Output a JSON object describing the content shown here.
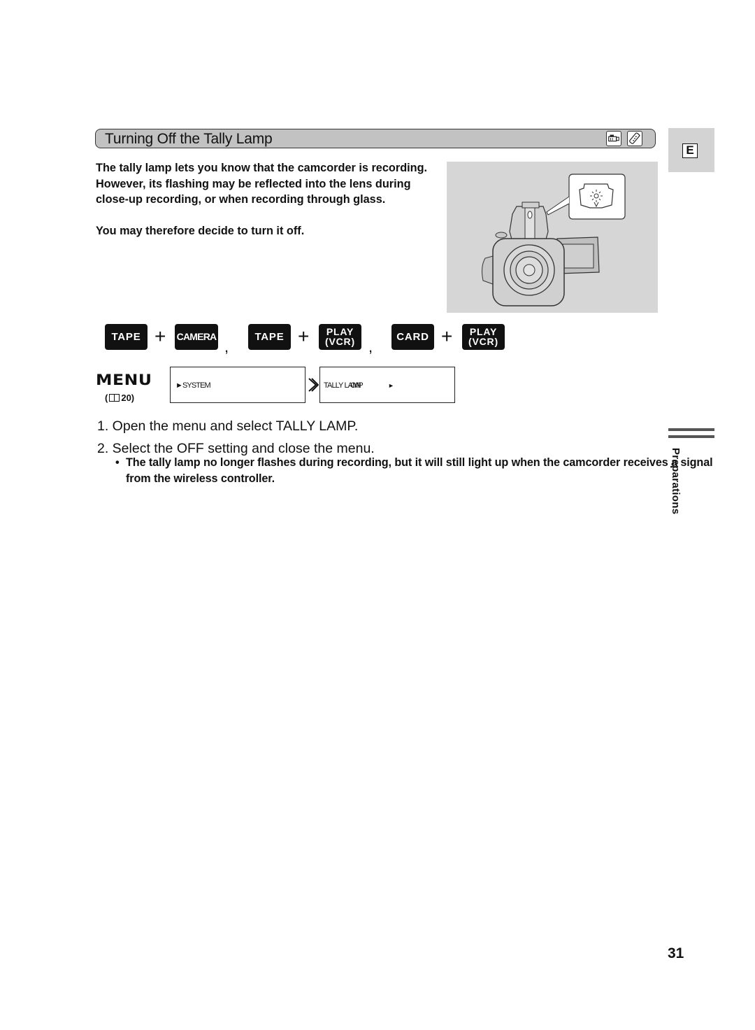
{
  "section": {
    "title": "Turning Off the Tally Lamp",
    "mode_icons": [
      "camcorder-icon",
      "wireless-controller-icon"
    ]
  },
  "language_tab": {
    "label": "E"
  },
  "intro": {
    "lines": [
      "The tally lamp lets you know that the camcorder is recording.",
      "However, its flashing may be reflected into the lens during",
      "close-up recording, or when recording through glass."
    ],
    "note": "You may therefore decide to turn it off."
  },
  "illustration": {
    "subject": "camcorder-front-with-tally-lamp-callout",
    "background": "#d6d6d6"
  },
  "modes": [
    {
      "dial": "TAPE",
      "mode_line1": "CAMERA",
      "mode_line2": ""
    },
    {
      "dial": "TAPE",
      "mode_line1": "PLAY",
      "mode_line2": "(VCR)"
    },
    {
      "dial": "CARD",
      "mode_line1": "PLAY",
      "mode_line2": "(VCR)"
    }
  ],
  "mode_separators": {
    "plus": "+",
    "comma": ","
  },
  "menu": {
    "label": "MENU",
    "page_ref_open": "(",
    "page_ref_number": "20)",
    "step1": "►SYSTEM",
    "step2_item": "TALLY LAMP",
    "step2_value": "ON",
    "step2_arrow": "►"
  },
  "steps": [
    "1.  Open the menu and select TALLY LAMP.",
    "2.  Select the OFF setting and close the menu."
  ],
  "note": {
    "bullet": "•",
    "text": "The tally lamp no longer flashes during recording, but it will still light up when the camcorder receives a signal from the wireless controller."
  },
  "chapter": {
    "label": "Preparations"
  },
  "page_number": "31",
  "colors": {
    "header_bar": "#c2c2c2",
    "key_background": "#111111",
    "key_text": "#ffffff",
    "tab_background": "#d3d3d3"
  }
}
